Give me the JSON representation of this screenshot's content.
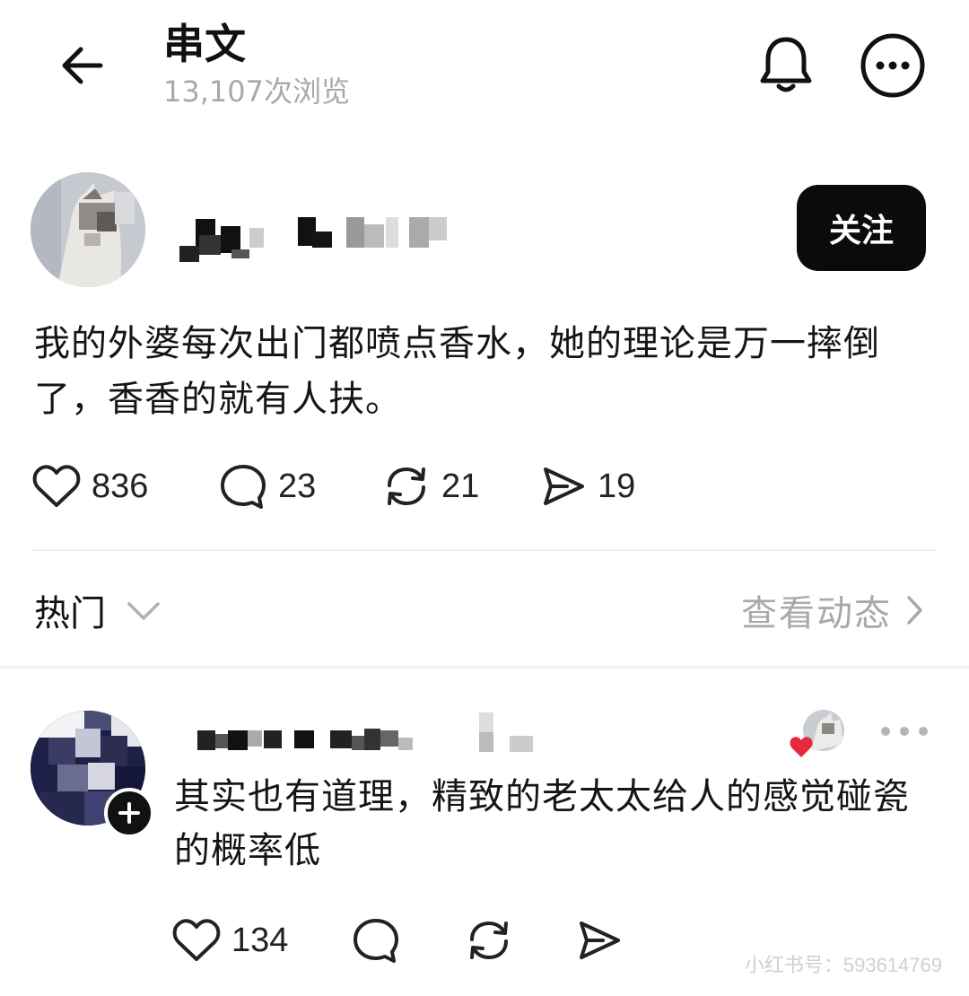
{
  "header": {
    "title": "串文",
    "views": "13,107次浏览",
    "back_icon": "back-arrow-icon",
    "bell_icon": "bell-icon",
    "more_icon": "more-circle-icon"
  },
  "post": {
    "follow_label": "关注",
    "text": "我的外婆每次出门都喷点香水，她的理论是万一摔倒了，香香的就有人扶。",
    "likes": "836",
    "comments": "23",
    "reposts": "21",
    "shares": "19"
  },
  "filter": {
    "sort_label": "热门",
    "view_activity_label": "查看动态"
  },
  "comment": {
    "text": "其实也有道理，精致的老太太给人的感觉碰瓷的概率低",
    "likes": "134"
  },
  "watermark": "小红书号：593614769",
  "colors": {
    "follow_button_bg": "#0b0b0b",
    "muted_text": "#a9a9a9",
    "like_heart": "#e8283c"
  }
}
